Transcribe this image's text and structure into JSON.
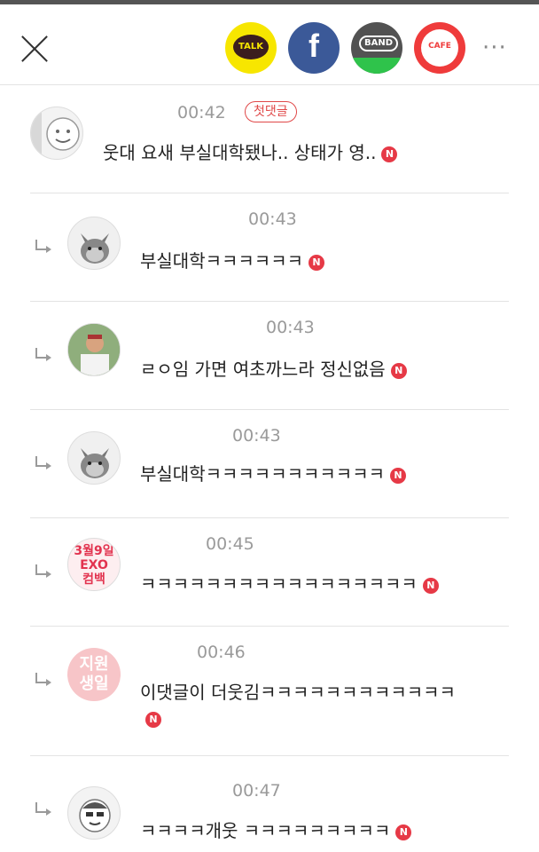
{
  "header": {
    "share_buttons": [
      {
        "name": "kakaotalk",
        "label": "TALK",
        "color": "#f7e600"
      },
      {
        "name": "facebook",
        "label": "f",
        "color": "#3b5998"
      },
      {
        "name": "band",
        "label": "BAND",
        "color": "#525252"
      },
      {
        "name": "cafe",
        "label": "CAFE",
        "color": "#ef3b3b"
      }
    ],
    "more_label": "···"
  },
  "new_badge": "N",
  "comments": [
    {
      "time": "00:42",
      "badge": "첫댓글",
      "text": "웃대 요새 부실대학됐나.. 상태가 영..",
      "avatar": "character-icon",
      "reply": false
    },
    {
      "time": "00:43",
      "text": "부실대학ㅋㅋㅋㅋㅋㅋ",
      "avatar": "cat-icon",
      "reply": true
    },
    {
      "time": "00:43",
      "text": "ㄹㅇ임 가면 여초까느라 정신없음",
      "avatar": "photo",
      "reply": true
    },
    {
      "time": "00:43",
      "text": "부실대학ㅋㅋㅋㅋㅋㅋㅋㅋㅋㅋㅋ",
      "avatar": "cat-icon",
      "reply": true
    },
    {
      "time": "00:45",
      "text": "ㅋㅋㅋㅋㅋㅋㅋㅋㅋㅋㅋㅋㅋㅋㅋㅋㅋ",
      "avatar_text": [
        "3월9일",
        "EXO",
        "컴백"
      ],
      "reply": true
    },
    {
      "time": "00:46",
      "text": "이댓글이 더웃김ㅋㅋㅋㅋㅋㅋㅋㅋㅋㅋㅋㅋ",
      "avatar_text": [
        "지원",
        "생일"
      ],
      "reply": true
    },
    {
      "time": "00:47",
      "text": "ㅋㅋㅋㅋ개웃 ㅋㅋㅋㅋㅋㅋㅋㅋㅋ",
      "avatar": "character-icon",
      "reply": true
    }
  ]
}
